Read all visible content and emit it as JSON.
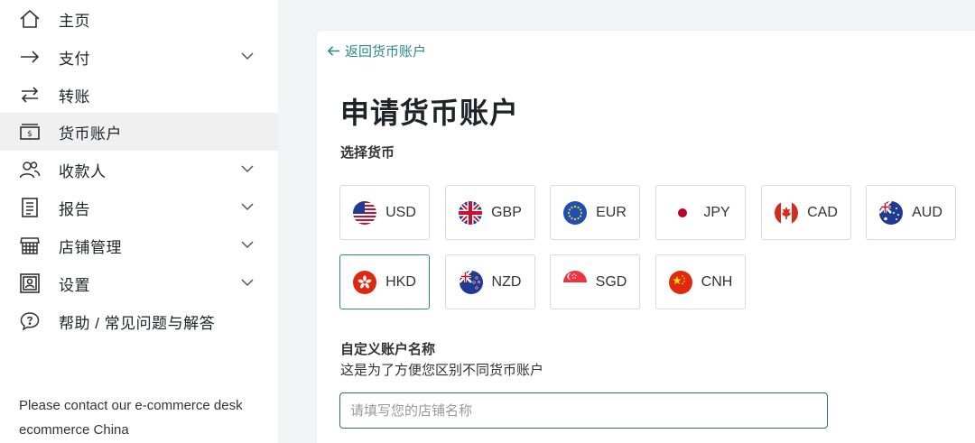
{
  "sidebar": {
    "items": [
      {
        "label": "主页",
        "icon": "home-icon"
      },
      {
        "label": "支付",
        "icon": "arrow-right-icon"
      },
      {
        "label": "转账",
        "icon": "transfer-icon"
      },
      {
        "label": "货币账户",
        "icon": "wallet-icon"
      },
      {
        "label": "收款人",
        "icon": "people-icon"
      },
      {
        "label": "报告",
        "icon": "report-icon"
      },
      {
        "label": "店铺管理",
        "icon": "store-icon"
      },
      {
        "label": "设置",
        "icon": "settings-icon"
      },
      {
        "label": "帮助 / 常见问题与解答",
        "icon": "help-icon"
      }
    ],
    "active_item": "货币账户",
    "footer_line1": "Please contact our e-commerce desk",
    "footer_line2": "ecommerce China"
  },
  "main": {
    "back_link": "返回货币账户",
    "title": "申请货币账户",
    "currency_section_label": "选择货币",
    "currencies": [
      "USD",
      "GBP",
      "EUR",
      "JPY",
      "CAD",
      "AUD",
      "HKD",
      "NZD",
      "SGD",
      "CNH"
    ],
    "selected_currency": "HKD",
    "name_field_label": "自定义账户名称",
    "name_field_help": "这是为了方便您区别不同货币账户",
    "name_field_placeholder": "请填写您的店铺名称",
    "name_field_value": ""
  },
  "colors": {
    "accent": "#2b8a86",
    "active_bg": "#f0f0f0",
    "page_bg": "#f3f4f6"
  }
}
